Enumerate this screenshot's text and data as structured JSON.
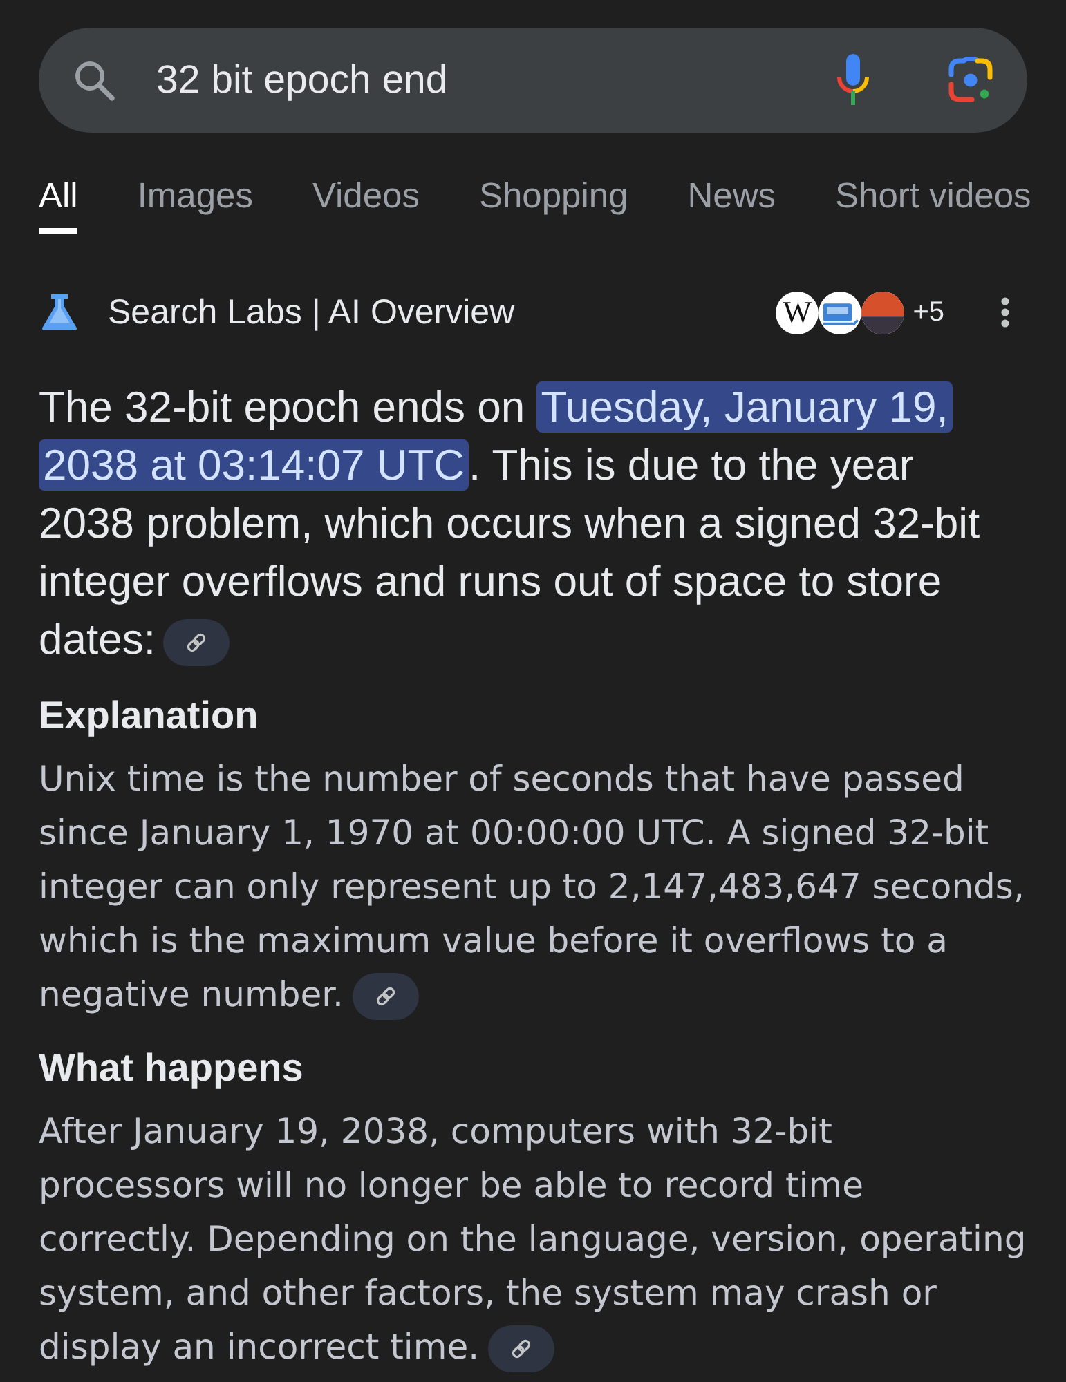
{
  "search": {
    "query": "32 bit epoch end"
  },
  "tabs": [
    {
      "label": "All",
      "selected": true
    },
    {
      "label": "Images",
      "selected": false
    },
    {
      "label": "Videos",
      "selected": false
    },
    {
      "label": "Shopping",
      "selected": false
    },
    {
      "label": "News",
      "selected": false
    },
    {
      "label": "Short videos",
      "selected": false
    }
  ],
  "overview": {
    "title": "Search Labs | AI Overview",
    "sources": [
      {
        "kind": "letter",
        "letter": "W"
      },
      {
        "kind": "monitor"
      },
      {
        "kind": "split"
      }
    ],
    "more_sources": "+5"
  },
  "answer": {
    "segments": [
      {
        "text": "The 32-bit epoch ends on ",
        "highlighted": false
      },
      {
        "text": "Tuesday, January 19, 2038 at 03:14:07 UTC",
        "highlighted": true
      },
      {
        "text": ". This is due to the year 2038 problem, which occurs when a signed 32-bit integer overflows and runs out of space to store dates:",
        "highlighted": false
      }
    ],
    "link_chip": true
  },
  "sections": [
    {
      "heading": "Explanation",
      "text": "Unix time is the number of seconds that have passed since January 1, 1970 at 00:00:00 UTC. A signed 32-bit integer can only represent up to 2,147,483,647 seconds, which is the maximum value before it overflows to a negative number.",
      "link_chip": true
    },
    {
      "heading": "What happens",
      "text": "After January 19, 2038, computers with 32-bit processors will no longer be able to record time correctly. Depending on the language, version, operating system, and other factors, the system may crash or display an incorrect time.",
      "link_chip": true
    }
  ]
}
